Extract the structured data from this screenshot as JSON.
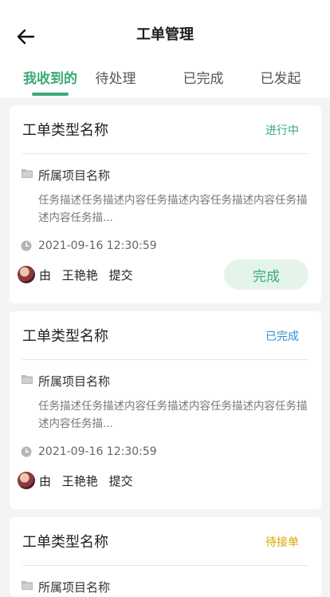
{
  "header": {
    "title": "工单管理"
  },
  "tabs": [
    {
      "label": "我收到的",
      "active": true
    },
    {
      "label": "待处理",
      "active": false
    },
    {
      "label": "已完成",
      "active": false
    },
    {
      "label": "已发起",
      "active": false
    }
  ],
  "colors": {
    "accent": "#3aa976",
    "status_in_progress": "#3aa976",
    "status_done": "#2f8fd6",
    "status_waiting": "#e0a200"
  },
  "cards": [
    {
      "type_name": "工单类型名称",
      "status": "进行中",
      "project": "所属项目名称",
      "description": "任务描述任务描述内容任务描述内容任务描述内容任务描述内容任务描...",
      "time": "2021-09-16   12:30:59",
      "submit_prefix": "由",
      "submitter": "王艳艳",
      "submit_suffix": "提交",
      "action_label": "完成"
    },
    {
      "type_name": "工单类型名称",
      "status": "已完成",
      "project": "所属项目名称",
      "description": "任务描述任务描述内容任务描述内容任务描述内容任务描述内容任务描...",
      "time": "2021-09-16   12:30:59",
      "submit_prefix": "由",
      "submitter": "王艳艳",
      "submit_suffix": "提交"
    },
    {
      "type_name": "工单类型名称",
      "status": "待接单",
      "project": "所属项目名称"
    }
  ]
}
